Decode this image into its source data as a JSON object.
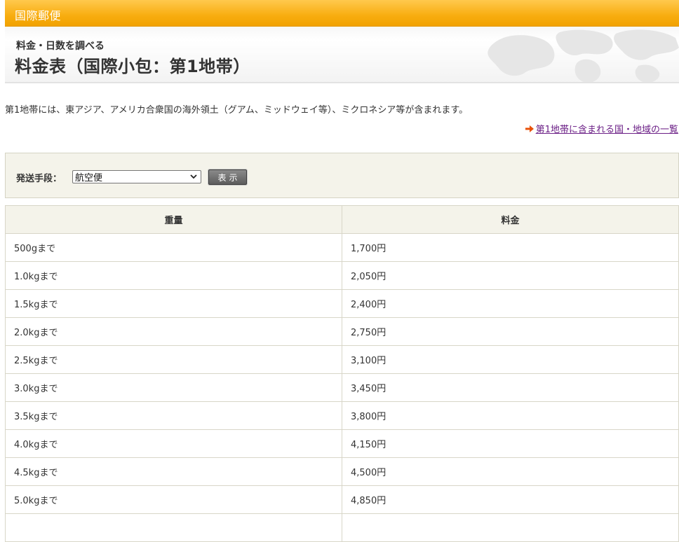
{
  "topbar": {
    "title": "国際郵便"
  },
  "header": {
    "subtitle": "料金・日数を調べる",
    "title": "料金表（国際小包：第1地帯）"
  },
  "description": "第1地帯には、東アジア、アメリカ合衆国の海外領土（グアム、ミッドウェイ等）、ミクロネシア等が含まれます。",
  "country_link": {
    "label": "第1地帯に含まれる国・地域の一覧"
  },
  "form": {
    "label": "発送手段：",
    "selected_method": "航空便",
    "show_button": "表示"
  },
  "table": {
    "headers": [
      "重量",
      "料金"
    ],
    "rows": [
      [
        "500gまで",
        "1,700円"
      ],
      [
        "1.0kgまで",
        "2,050円"
      ],
      [
        "1.5kgまで",
        "2,400円"
      ],
      [
        "2.0kgまで",
        "2,750円"
      ],
      [
        "2.5kgまで",
        "3,100円"
      ],
      [
        "3.0kgまで",
        "3,450円"
      ],
      [
        "3.5kgまで",
        "3,800円"
      ],
      [
        "4.0kgまで",
        "4,150円"
      ],
      [
        "4.5kgまで",
        "4,500円"
      ],
      [
        "5.0kgまで",
        "4,850円"
      ],
      [
        "",
        ""
      ]
    ]
  },
  "colors": {
    "accent_orange": "#f8ad10",
    "link_purple": "#6b1f86",
    "arrow_orange": "#e8520a",
    "panel_beige": "#f4f3ea"
  },
  "icons": [
    "world-map-icon",
    "arrow-right-icon",
    "chevron-down-icon"
  ]
}
